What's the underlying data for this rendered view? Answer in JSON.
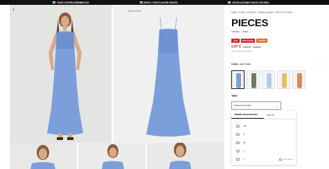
{
  "topbar": {
    "items": [
      {
        "icon": "truck-icon",
        "label": "PAGO CONTRA REEMBOLSO"
      },
      {
        "icon": "box-icon",
        "label": "ENVÍO Y DEVOLUCIÓN GRATIS"
      },
      {
        "icon": "return-icon",
        "label": "DEVOLUCIONES HASTA 100 DÍAS"
      }
    ]
  },
  "gallery": {
    "back_icon": "‹",
    "fullview_label": "Más producto"
  },
  "product": {
    "breadcrumb": "Mujer / Ropa / Vestidos / Vestidos largos / PIECES Vestido ...",
    "brand": "PIECES",
    "name": "Vestido - Claire",
    "badges": [
      {
        "label": "-20%",
        "color": "#d8232a"
      },
      {
        "label": "20% EXTRA",
        "color": "#d8232a"
      },
      {
        "label": "CUPÓN",
        "color": "#ea6b2c"
      }
    ],
    "price_now": "5,97 €",
    "price_old": "29,99 €",
    "price_extra": "39,99 €",
    "price_note": "Precio más bajo anterior"
  },
  "colors": {
    "label": "Color:",
    "selected": "azul claro",
    "prev_icon": "‹",
    "next_icon": "›",
    "swatches": [
      {
        "name": "azul claro",
        "color": "#7c9fdc",
        "active": true
      },
      {
        "name": "verde oliva",
        "color": "#6e7a5c",
        "active": false
      },
      {
        "name": "azul pálido",
        "color": "#b7cbe8",
        "active": false
      },
      {
        "name": "amarillo",
        "color": "#e7c25e",
        "active": false
      },
      {
        "name": "naranja",
        "color": "#d78a55",
        "active": false
      }
    ]
  },
  "size": {
    "title": "Talla",
    "placeholder": "Seleccionar talla",
    "caret": "⌄",
    "tabs": [
      "Tamaño del proveedor",
      "Talla ES"
    ],
    "options": [
      {
        "label": "XS",
        "disabled": false
      },
      {
        "label": "S",
        "disabled": false
      },
      {
        "label": "M",
        "disabled": false
      },
      {
        "label": "L",
        "disabled": false
      },
      {
        "label": "XL",
        "disabled": true,
        "note": "Recordarme"
      }
    ]
  }
}
